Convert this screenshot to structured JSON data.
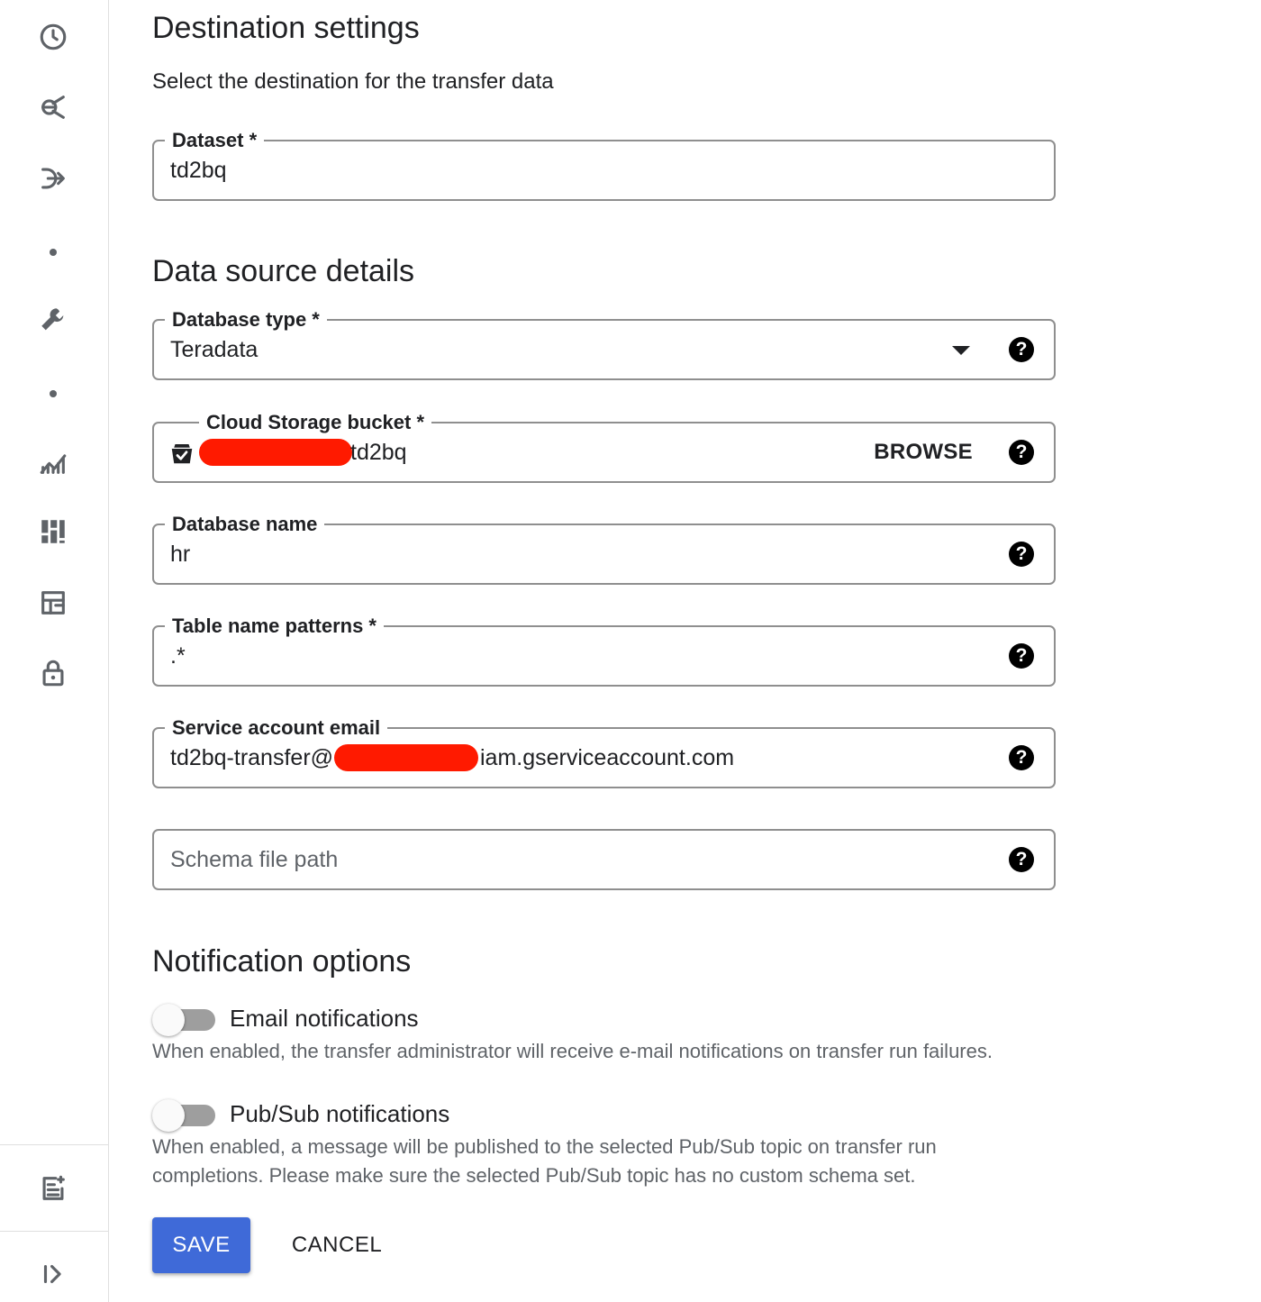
{
  "rail": {
    "icons": [
      "history-icon",
      "explore-icon",
      "transfer-icon",
      "wrench-icon",
      "analytics-icon",
      "dashboard-icon",
      "table-icon",
      "lock-icon",
      "release-notes-icon",
      "expand-icon"
    ]
  },
  "destination": {
    "title": "Destination settings",
    "subtitle": "Select the destination for the transfer data",
    "dataset": {
      "label": "Dataset *",
      "value": "td2bq"
    }
  },
  "source": {
    "title": "Data source details",
    "database_type": {
      "label": "Database type *",
      "value": "Teradata",
      "help": "?"
    },
    "bucket": {
      "label": "Cloud Storage bucket *",
      "value_suffix": "td2bq",
      "browse_label": "BROWSE",
      "help": "?"
    },
    "database_name": {
      "label": "Database name",
      "value": "hr",
      "help": "?"
    },
    "table_patterns": {
      "label": "Table name patterns *",
      "value": ".*",
      "help": "?"
    },
    "service_account": {
      "label": "Service account email",
      "value_prefix": "td2bq-transfer@",
      "value_suffix": "iam.gserviceaccount.com",
      "help": "?"
    },
    "schema_path": {
      "placeholder": "Schema file path",
      "value": "",
      "help": "?"
    }
  },
  "notifications": {
    "title": "Notification options",
    "email": {
      "label": "Email notifications",
      "enabled": false,
      "description": "When enabled, the transfer administrator will receive e-mail notifications on transfer run failures."
    },
    "pubsub": {
      "label": "Pub/Sub notifications",
      "enabled": false,
      "description": "When enabled, a message will be published to the selected Pub/Sub topic on transfer run completions. Please make sure the selected Pub/Sub topic has no custom schema set."
    }
  },
  "actions": {
    "save_label": "SAVE",
    "cancel_label": "CANCEL"
  },
  "colors": {
    "primary": "#3f6ad8",
    "redaction": "#ff1a00",
    "icon": "#5f6368"
  }
}
